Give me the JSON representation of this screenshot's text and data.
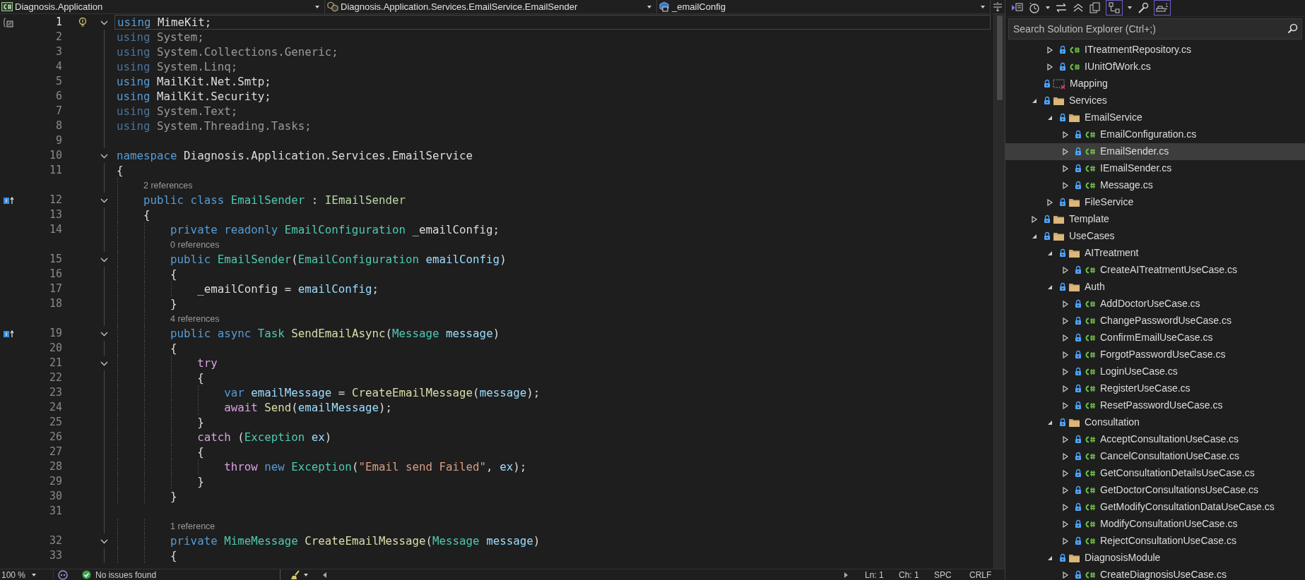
{
  "nav_bar": {
    "project": "Diagnosis.Application",
    "type": "Diagnosis.Application.Services.EmailService.EmailSender",
    "member": "_emailConfig"
  },
  "editor": {
    "lines": [
      {
        "kind": "code",
        "number": "1",
        "current": true,
        "fold": true,
        "scope_marker": true,
        "lightbulb": true,
        "tokens": [
          {
            "kind": "keyword",
            "text": "using "
          },
          {
            "kind": "plain",
            "text": "MimeKit;"
          }
        ]
      },
      {
        "kind": "code",
        "number": "2",
        "current": false,
        "fold": false,
        "tokens": [
          {
            "kind": "keyword_dim",
            "text": "using "
          },
          {
            "kind": "plain_dim",
            "text": "System;"
          }
        ]
      },
      {
        "kind": "code",
        "number": "3",
        "current": false,
        "fold": false,
        "tokens": [
          {
            "kind": "keyword_dim",
            "text": "using "
          },
          {
            "kind": "plain_dim",
            "text": "System.Collections.Generic;"
          }
        ]
      },
      {
        "kind": "code",
        "number": "4",
        "current": false,
        "fold": false,
        "tokens": [
          {
            "kind": "keyword_dim",
            "text": "using "
          },
          {
            "kind": "plain_dim",
            "text": "System.Linq;"
          }
        ]
      },
      {
        "kind": "code",
        "number": "5",
        "current": false,
        "fold": false,
        "tokens": [
          {
            "kind": "keyword",
            "text": "using "
          },
          {
            "kind": "plain",
            "text": "MailKit.Net.Smtp;"
          }
        ]
      },
      {
        "kind": "code",
        "number": "6",
        "current": false,
        "fold": false,
        "tokens": [
          {
            "kind": "keyword",
            "text": "using "
          },
          {
            "kind": "plain",
            "text": "MailKit.Security;"
          }
        ]
      },
      {
        "kind": "code",
        "number": "7",
        "current": false,
        "fold": false,
        "tokens": [
          {
            "kind": "keyword_dim",
            "text": "using "
          },
          {
            "kind": "plain_dim",
            "text": "System.Text;"
          }
        ]
      },
      {
        "kind": "code",
        "number": "8",
        "current": false,
        "fold": false,
        "tokens": [
          {
            "kind": "keyword_dim",
            "text": "using "
          },
          {
            "kind": "plain_dim",
            "text": "System.Threading.Tasks;"
          }
        ]
      },
      {
        "kind": "code",
        "number": "9",
        "current": false,
        "fold": false
      },
      {
        "kind": "code",
        "number": "10",
        "current": false,
        "fold": true,
        "tokens": [
          {
            "kind": "keyword",
            "text": "namespace "
          },
          {
            "kind": "plain",
            "text": "Diagnosis.Application.Services.EmailService"
          }
        ]
      },
      {
        "kind": "code",
        "number": "11",
        "current": false,
        "fold": false,
        "tokens": [
          {
            "kind": "plain",
            "text": "{"
          }
        ]
      },
      {
        "kind": "lens",
        "text": "2 references"
      },
      {
        "kind": "code",
        "number": "12",
        "current": false,
        "fold": true,
        "implements_marker": true,
        "tokens": [
          {
            "kind": "keyword",
            "text": "    public class "
          },
          {
            "kind": "type",
            "text": "EmailSender"
          },
          {
            "kind": "plain",
            "text": " : "
          },
          {
            "kind": "interface",
            "text": "IEmailSender"
          }
        ]
      },
      {
        "kind": "code",
        "number": "13",
        "current": false,
        "fold": false,
        "tokens": [
          {
            "kind": "plain",
            "text": "    {"
          }
        ]
      },
      {
        "kind": "code",
        "number": "14",
        "current": false,
        "fold": false,
        "tokens": [
          {
            "kind": "keyword",
            "text": "        private readonly "
          },
          {
            "kind": "type",
            "text": "EmailConfiguration"
          },
          {
            "kind": "plain",
            "text": " _emailConfig;"
          }
        ]
      },
      {
        "kind": "lens",
        "text": "0 references"
      },
      {
        "kind": "code",
        "number": "15",
        "current": false,
        "fold": true,
        "tokens": [
          {
            "kind": "keyword",
            "text": "        public "
          },
          {
            "kind": "type",
            "text": "EmailSender"
          },
          {
            "kind": "plain",
            "text": "("
          },
          {
            "kind": "type",
            "text": "EmailConfiguration "
          },
          {
            "kind": "variable",
            "text": "emailConfig"
          },
          {
            "kind": "plain",
            "text": ")"
          }
        ]
      },
      {
        "kind": "code",
        "number": "16",
        "current": false,
        "fold": false,
        "tokens": [
          {
            "kind": "plain",
            "text": "        {"
          }
        ]
      },
      {
        "kind": "code",
        "number": "17",
        "current": false,
        "fold": false,
        "tokens": [
          {
            "kind": "plain",
            "text": "            _emailConfig = "
          },
          {
            "kind": "variable",
            "text": "emailConfig"
          },
          {
            "kind": "plain",
            "text": ";"
          }
        ]
      },
      {
        "kind": "code",
        "number": "18",
        "current": false,
        "fold": false,
        "tokens": [
          {
            "kind": "plain",
            "text": "        }"
          }
        ]
      },
      {
        "kind": "lens",
        "text": "4 references"
      },
      {
        "kind": "code",
        "number": "19",
        "current": false,
        "fold": true,
        "implements_marker": true,
        "tokens": [
          {
            "kind": "keyword",
            "text": "        public async "
          },
          {
            "kind": "type",
            "text": "Task "
          },
          {
            "kind": "method",
            "text": "SendEmailAsync"
          },
          {
            "kind": "plain",
            "text": "("
          },
          {
            "kind": "type",
            "text": "Message "
          },
          {
            "kind": "variable",
            "text": "message"
          },
          {
            "kind": "plain",
            "text": ")"
          }
        ]
      },
      {
        "kind": "code",
        "number": "20",
        "current": false,
        "fold": false,
        "tokens": [
          {
            "kind": "plain",
            "text": "        {"
          }
        ]
      },
      {
        "kind": "code",
        "number": "21",
        "current": false,
        "fold": true,
        "tokens": [
          {
            "kind": "control",
            "text": "            try"
          }
        ]
      },
      {
        "kind": "code",
        "number": "22",
        "current": false,
        "fold": false,
        "tokens": [
          {
            "kind": "plain",
            "text": "            {"
          }
        ]
      },
      {
        "kind": "code",
        "number": "23",
        "current": false,
        "fold": false,
        "tokens": [
          {
            "kind": "keyword",
            "text": "                var "
          },
          {
            "kind": "variable",
            "text": "emailMessage"
          },
          {
            "kind": "plain",
            "text": " = "
          },
          {
            "kind": "method",
            "text": "CreateEmailMessage"
          },
          {
            "kind": "plain",
            "text": "("
          },
          {
            "kind": "variable",
            "text": "message"
          },
          {
            "kind": "plain",
            "text": ");"
          }
        ]
      },
      {
        "kind": "code",
        "number": "24",
        "current": false,
        "fold": false,
        "tokens": [
          {
            "kind": "control",
            "text": "                await "
          },
          {
            "kind": "method",
            "text": "Send"
          },
          {
            "kind": "plain",
            "text": "("
          },
          {
            "kind": "variable",
            "text": "emailMessage"
          },
          {
            "kind": "plain",
            "text": ");"
          }
        ]
      },
      {
        "kind": "code",
        "number": "25",
        "current": false,
        "fold": false,
        "tokens": [
          {
            "kind": "plain",
            "text": "            }"
          }
        ]
      },
      {
        "kind": "code",
        "number": "26",
        "current": false,
        "fold": false,
        "tokens": [
          {
            "kind": "control",
            "text": "            catch "
          },
          {
            "kind": "plain",
            "text": "("
          },
          {
            "kind": "type",
            "text": "Exception "
          },
          {
            "kind": "variable",
            "text": "ex"
          },
          {
            "kind": "plain",
            "text": ")"
          }
        ]
      },
      {
        "kind": "code",
        "number": "27",
        "current": false,
        "fold": false,
        "tokens": [
          {
            "kind": "plain",
            "text": "            {"
          }
        ]
      },
      {
        "kind": "code",
        "number": "28",
        "current": false,
        "fold": false,
        "tokens": [
          {
            "kind": "control",
            "text": "                throw "
          },
          {
            "kind": "keyword",
            "text": "new "
          },
          {
            "kind": "type",
            "text": "Exception"
          },
          {
            "kind": "plain",
            "text": "("
          },
          {
            "kind": "string",
            "text": "\"Email send Failed\""
          },
          {
            "kind": "plain",
            "text": ", "
          },
          {
            "kind": "variable",
            "text": "ex"
          },
          {
            "kind": "plain",
            "text": ");"
          }
        ]
      },
      {
        "kind": "code",
        "number": "29",
        "current": false,
        "fold": false,
        "tokens": [
          {
            "kind": "plain",
            "text": "            }"
          }
        ]
      },
      {
        "kind": "code",
        "number": "30",
        "current": false,
        "fold": false,
        "tokens": [
          {
            "kind": "plain",
            "text": "        }"
          }
        ]
      },
      {
        "kind": "code",
        "number": "31",
        "current": false,
        "fold": false
      },
      {
        "kind": "lens",
        "text": "1 reference"
      },
      {
        "kind": "code",
        "number": "32",
        "current": false,
        "fold": true,
        "tokens": [
          {
            "kind": "keyword",
            "text": "        private "
          },
          {
            "kind": "type",
            "text": "MimeMessage "
          },
          {
            "kind": "method",
            "text": "CreateEmailMessage"
          },
          {
            "kind": "plain",
            "text": "("
          },
          {
            "kind": "type",
            "text": "Message "
          },
          {
            "kind": "variable",
            "text": "message"
          },
          {
            "kind": "plain",
            "text": ")"
          }
        ]
      },
      {
        "kind": "code",
        "number": "33",
        "current": false,
        "fold": false,
        "tokens": [
          {
            "kind": "plain",
            "text": "        {"
          }
        ]
      }
    ]
  },
  "status_bar": {
    "zoom": "100 %",
    "issues": "No issues found",
    "line": "Ln: 1",
    "column": "Ch: 1",
    "spacing": "SPC",
    "line_ending": "CRLF"
  },
  "solution_explorer": {
    "search": {
      "placeholder": "Search Solution Explorer (Ctrl+;)"
    },
    "tree": [
      {
        "children": [
          {
            "name": "ITreatmentRepository.cs",
            "kind": "file",
            "expanded": false,
            "selected": false
          },
          {
            "name": "IUnitOfWork.cs",
            "kind": "file",
            "expanded": false,
            "selected": false
          }
        ]
      },
      {
        "name": "Mapping",
        "kind": "excluded",
        "selected": false
      },
      {
        "name": "Services",
        "kind": "folder",
        "expanded": true,
        "selected": false,
        "children": [
          {
            "name": "EmailService",
            "kind": "folder",
            "expanded": true,
            "selected": false,
            "children": [
              {
                "name": "EmailConfiguration.cs",
                "kind": "file",
                "expanded": false,
                "selected": false
              },
              {
                "name": "EmailSender.cs",
                "kind": "file",
                "expanded": false,
                "selected": true
              },
              {
                "name": "IEmailSender.cs",
                "kind": "file",
                "expanded": false,
                "selected": false
              },
              {
                "name": "Message.cs",
                "kind": "file",
                "expanded": false,
                "selected": false
              }
            ]
          },
          {
            "name": "FileService",
            "kind": "folder",
            "expanded": false,
            "selected": false
          }
        ]
      },
      {
        "name": "Template",
        "kind": "folder",
        "expanded": false,
        "selected": false
      },
      {
        "name": "UseCases",
        "kind": "folder",
        "expanded": true,
        "selected": false,
        "children": [
          {
            "name": "AITreatment",
            "kind": "folder",
            "expanded": true,
            "selected": false,
            "children": [
              {
                "name": "CreateAITreatmentUseCase.cs",
                "kind": "file",
                "expanded": false,
                "selected": false
              }
            ]
          },
          {
            "name": "Auth",
            "kind": "folder",
            "expanded": true,
            "selected": false,
            "children": [
              {
                "name": "AddDoctorUseCase.cs",
                "kind": "file",
                "expanded": false,
                "selected": false
              },
              {
                "name": "ChangePasswordUseCase.cs",
                "kind": "file",
                "expanded": false,
                "selected": false
              },
              {
                "name": "ConfirmEmailUseCase.cs",
                "kind": "file",
                "expanded": false,
                "selected": false
              },
              {
                "name": "ForgotPasswordUseCase.cs",
                "kind": "file",
                "expanded": false,
                "selected": false
              },
              {
                "name": "LoginUseCase.cs",
                "kind": "file",
                "expanded": false,
                "selected": false
              },
              {
                "name": "RegisterUseCase.cs",
                "kind": "file",
                "expanded": false,
                "selected": false
              },
              {
                "name": "ResetPasswordUseCase.cs",
                "kind": "file",
                "expanded": false,
                "selected": false
              }
            ]
          },
          {
            "name": "Consultation",
            "kind": "folder",
            "expanded": true,
            "selected": false,
            "children": [
              {
                "name": "AcceptConsultationUseCase.cs",
                "kind": "file",
                "expanded": false,
                "selected": false
              },
              {
                "name": "CancelConsultationUseCase.cs",
                "kind": "file",
                "expanded": false,
                "selected": false
              },
              {
                "name": "GetConsultationDetailsUseCase.cs",
                "kind": "file",
                "expanded": false,
                "selected": false
              },
              {
                "name": "GetDoctorConsultationsUseCase.cs",
                "kind": "file",
                "expanded": false,
                "selected": false
              },
              {
                "name": "GetModifyConsultationDataUseCase.cs",
                "kind": "file",
                "expanded": false,
                "selected": false
              },
              {
                "name": "ModifyConsultationUseCase.cs",
                "kind": "file",
                "expanded": false,
                "selected": false
              },
              {
                "name": "RejectConsultationUseCase.cs",
                "kind": "file",
                "expanded": false,
                "selected": false
              }
            ]
          },
          {
            "name": "DiagnosisModule",
            "kind": "folder",
            "expanded": true,
            "selected": false,
            "children": [
              {
                "name": "CreateDiagnosisUseCase.cs",
                "kind": "file",
                "expanded": false,
                "selected": false
              }
            ]
          }
        ]
      }
    ]
  }
}
